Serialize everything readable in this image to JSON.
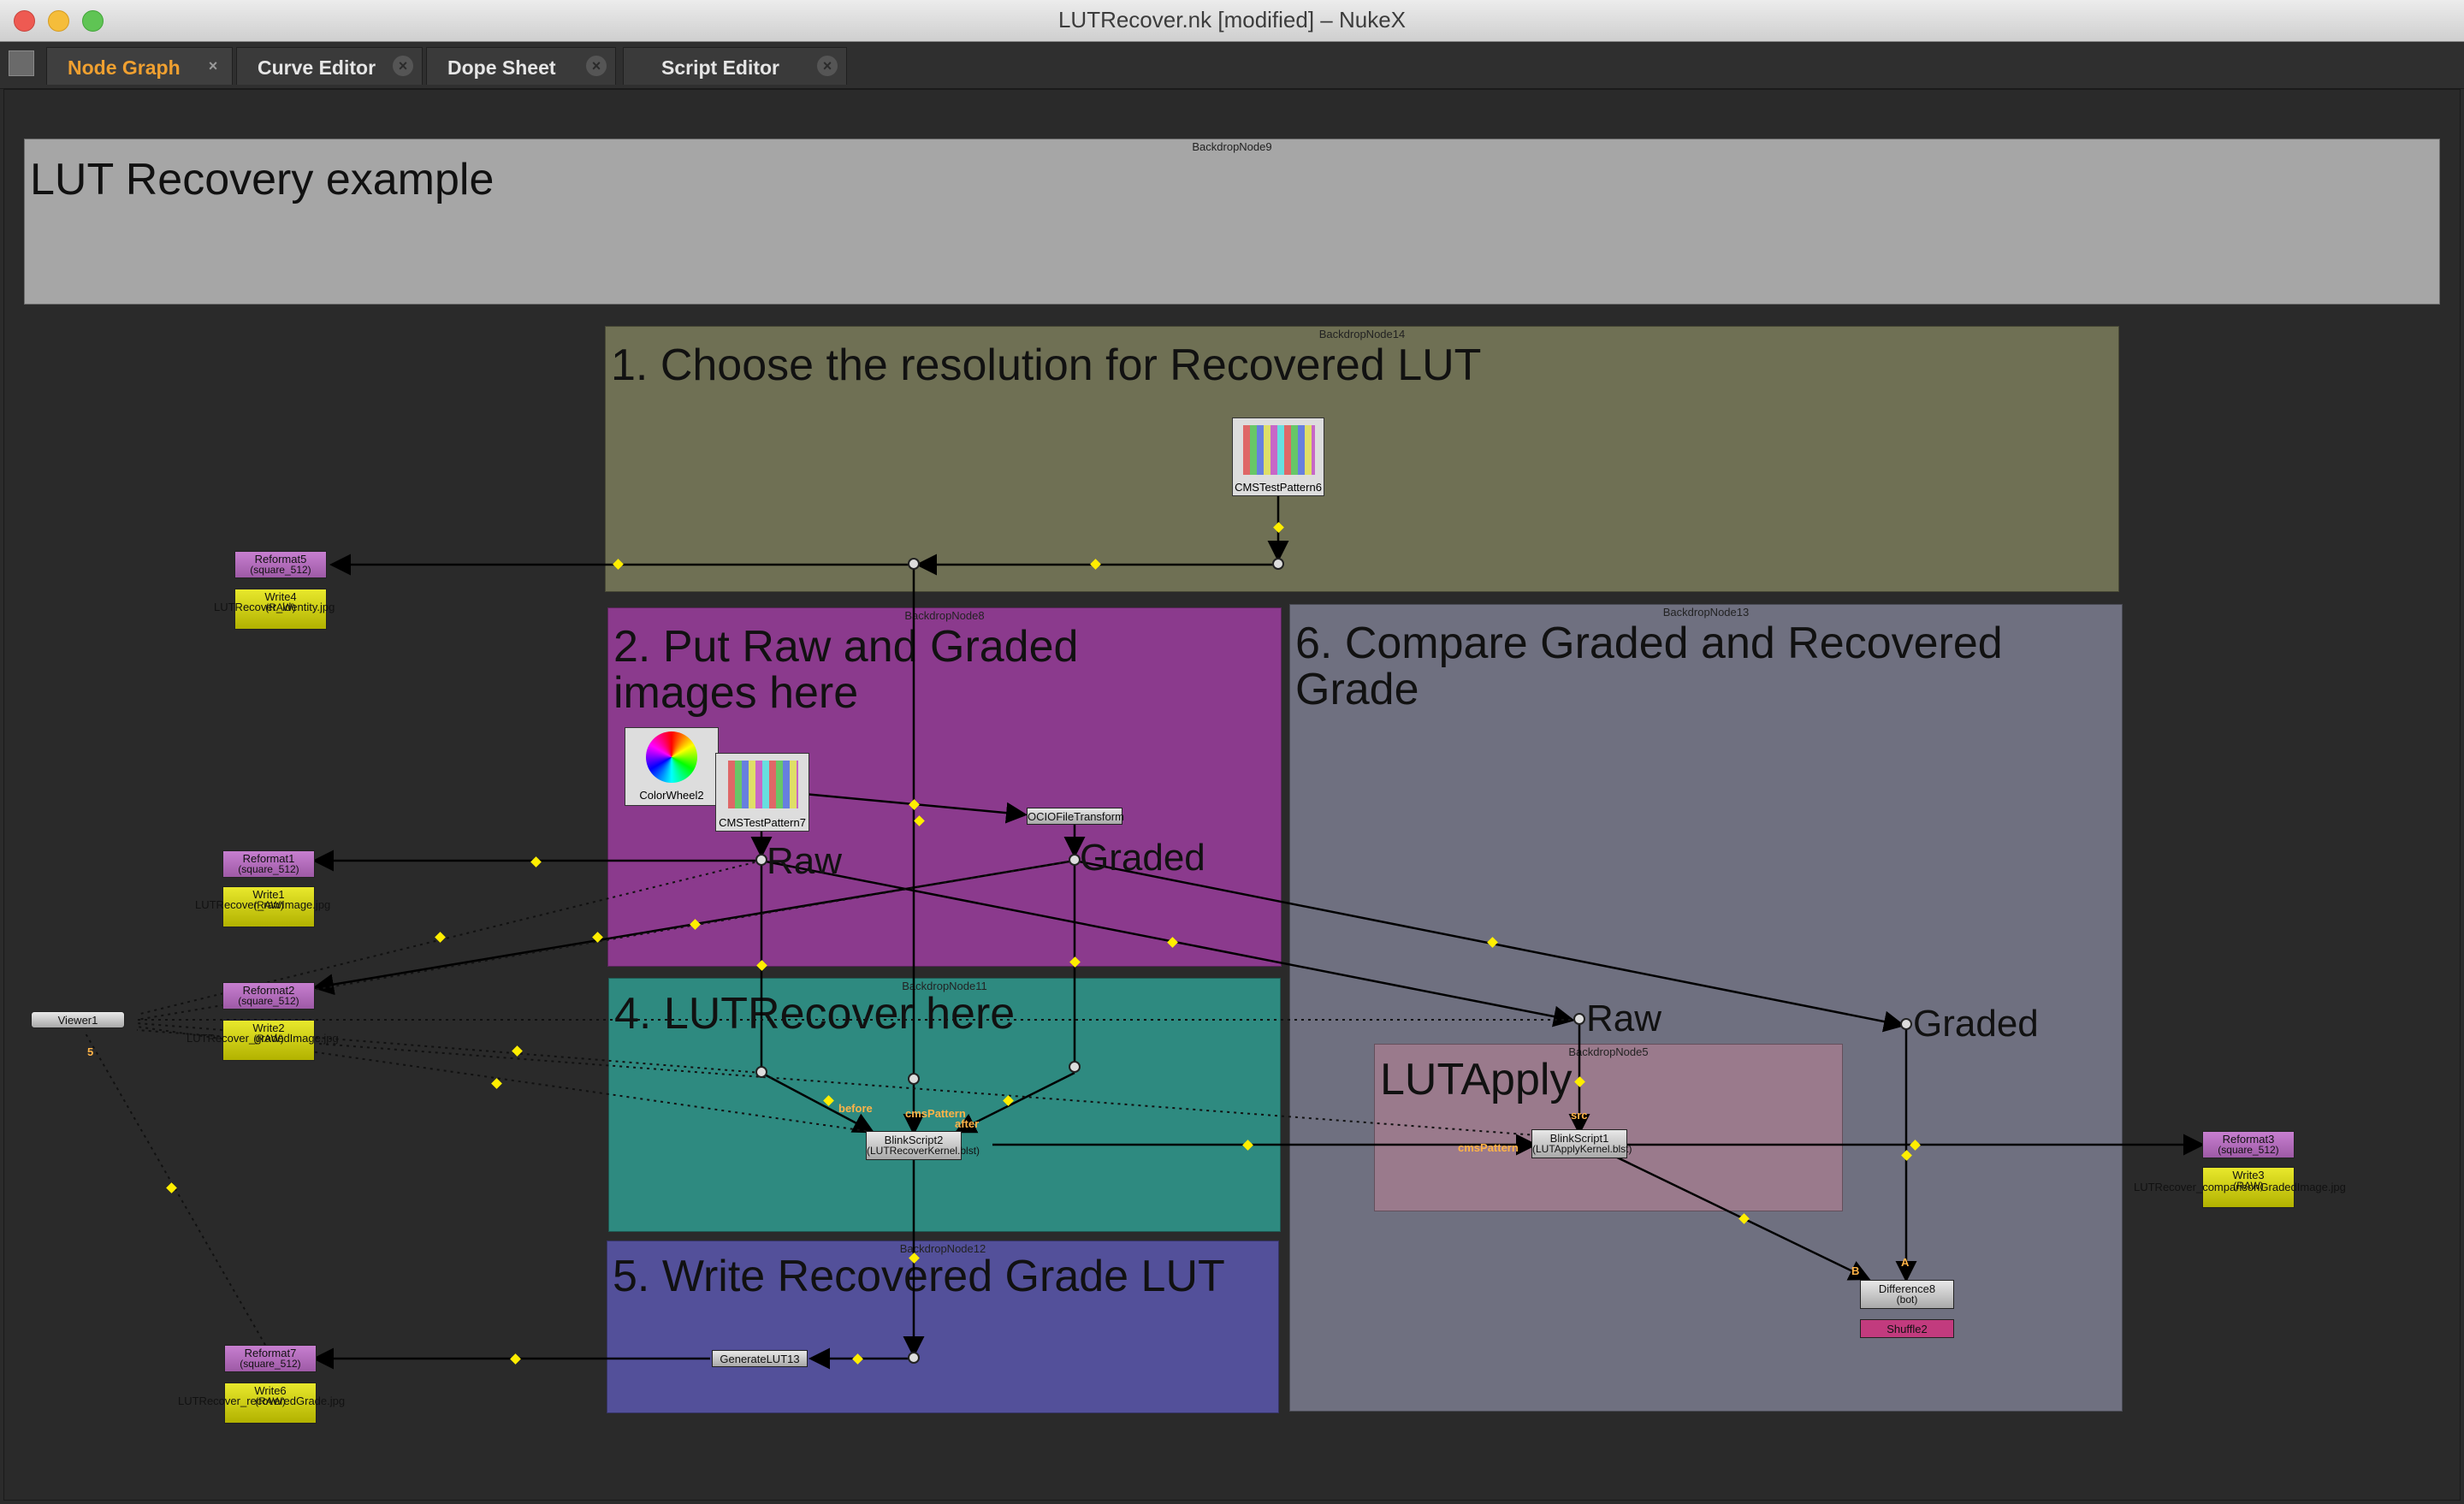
{
  "window": {
    "title": "LUTRecover.nk [modified] – NukeX"
  },
  "tabs": [
    {
      "label": "Node Graph",
      "active": true
    },
    {
      "label": "Curve Editor",
      "active": false
    },
    {
      "label": "Dope Sheet",
      "active": false
    },
    {
      "label": "Script Editor",
      "active": false
    }
  ],
  "tab_close_glyph": "×",
  "backdrops": {
    "bd9": {
      "name": "BackdropNode9",
      "label": "LUT Recovery example",
      "color": "#a6a6a6"
    },
    "bd14": {
      "name": "BackdropNode14",
      "label": "1. Choose the resolution for Recovered LUT",
      "color": "#6f7054"
    },
    "bd8": {
      "name": "BackdropNode8",
      "label": "2. Put Raw and Graded\nimages here",
      "color": "#8b3a8d"
    },
    "bd13": {
      "name": "BackdropNode13",
      "label": "6. Compare Graded and Recovered Grade",
      "color": "#6f7080"
    },
    "bd11": {
      "name": "BackdropNode11",
      "label": "4. LUTRecover here",
      "color": "#2e8a80"
    },
    "bd12": {
      "name": "BackdropNode12",
      "label": "5. Write Recovered Grade LUT",
      "color": "#53509a"
    },
    "bd5": {
      "name": "BackdropNode5",
      "label": "LUTApply",
      "color": "#9a7a8c"
    }
  },
  "nodes": {
    "reformat5": {
      "name": "Reformat5",
      "sub": "(square_512)"
    },
    "write4": {
      "name": "Write4",
      "sub": "(RAW)",
      "file": "LUTRecover_identity.jpg"
    },
    "reformat1": {
      "name": "Reformat1",
      "sub": "(square_512)"
    },
    "write1": {
      "name": "Write1",
      "sub": "(RAW)",
      "file": "LUTRecover_rawImage.jpg"
    },
    "reformat2": {
      "name": "Reformat2",
      "sub": "(square_512)"
    },
    "write2": {
      "name": "Write2",
      "sub": "(RAW)",
      "file": "LUTRecover_gradedImage.jpg"
    },
    "reformat7": {
      "name": "Reformat7",
      "sub": "(square_512)"
    },
    "write6": {
      "name": "Write6",
      "sub": "(RAW)",
      "file": "LUTRecover_recoveredGrade.jpg"
    },
    "reformat3": {
      "name": "Reformat3",
      "sub": "(square_512)"
    },
    "write3": {
      "name": "Write3",
      "sub": "(RAW)",
      "file": "LUTRecover_comparisonGradedImage.jpg"
    },
    "viewer1": {
      "name": "Viewer1"
    },
    "cmspattern6": {
      "name": "CMSTestPattern6"
    },
    "cmspattern7": {
      "name": "CMSTestPattern7"
    },
    "colorwheel2": {
      "name": "ColorWheel2"
    },
    "ociofile": {
      "name": "OCIOFileTransform"
    },
    "blink2": {
      "name": "BlinkScript2",
      "sub": "(LUTRecoverKernel.blst)"
    },
    "blink1": {
      "name": "BlinkScript1",
      "sub": "(LUTApplyKernel.blst)"
    },
    "generatelut": {
      "name": "GenerateLUT13"
    },
    "difference8": {
      "name": "Difference8",
      "sub": "(bot)"
    },
    "shuffle2": {
      "name": "Shuffle2"
    }
  },
  "dots_labels": {
    "raw1": "Raw",
    "graded1": "Graded",
    "raw2": "Raw",
    "graded2": "Graded"
  },
  "pipe_labels": {
    "before": "before",
    "cmsPattern": "cmsPattern",
    "after": "after",
    "src": "src",
    "cmsPattern2": "cmsPattern",
    "a": "A",
    "b": "B",
    "viewer_input": "5"
  }
}
